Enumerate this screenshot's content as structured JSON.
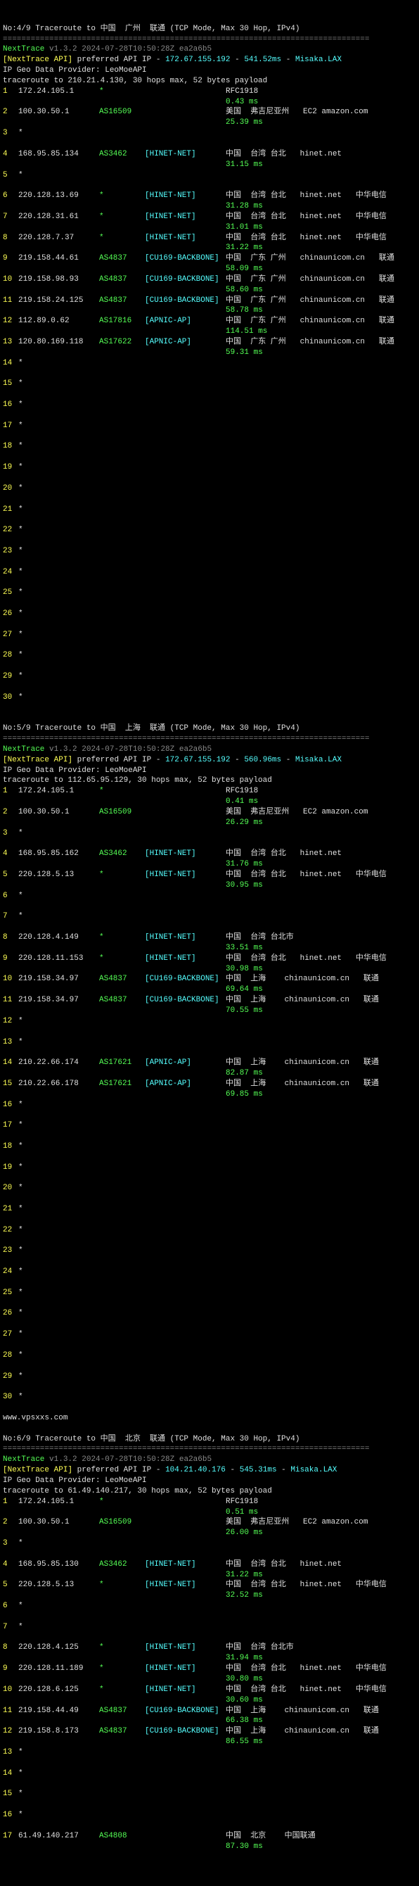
{
  "sections": [
    {
      "title_pre": "No:4/9 Traceroute to ",
      "title_loc": "中国  广州  联通",
      "title_suf": " (TCP Mode, Max 30 Hop, IPv4)",
      "api_ip": "172.67.155.192",
      "api_ms": "541.52ms",
      "isp": "Misaka.LAX",
      "trace_to": "210.21.4.130",
      "hops": [
        {
          "n": "1",
          "ip": "172.24.105.1",
          "as": "*",
          "net": "",
          "loc": "RFC1918",
          "lat": "0.43 ms"
        },
        {
          "n": "2",
          "ip": "100.30.50.1",
          "as": "AS16509",
          "net": "",
          "loc": "美国  弗吉尼亚州   EC2 amazon.com",
          "lat": "25.39 ms"
        },
        {
          "n": "3",
          "ip": "*",
          "as": "",
          "net": "",
          "loc": "",
          "lat": ""
        },
        {
          "n": "4",
          "ip": "168.95.85.134",
          "as": "AS3462",
          "net": "[HINET-NET]",
          "loc": "中国  台湾 台北   hinet.net",
          "lat": "31.15 ms"
        },
        {
          "n": "5",
          "ip": "*",
          "as": "",
          "net": "",
          "loc": "",
          "lat": ""
        },
        {
          "n": "6",
          "ip": "220.128.13.69",
          "as": "*",
          "net": "[HINET-NET]",
          "loc": "中国  台湾 台北   hinet.net   中华电信",
          "lat": "31.28 ms"
        },
        {
          "n": "7",
          "ip": "220.128.31.61",
          "as": "*",
          "net": "[HINET-NET]",
          "loc": "中国  台湾 台北   hinet.net   中华电信",
          "lat": "31.01 ms"
        },
        {
          "n": "8",
          "ip": "220.128.7.37",
          "as": "*",
          "net": "[HINET-NET]",
          "loc": "中国  台湾 台北   hinet.net   中华电信",
          "lat": "31.22 ms"
        },
        {
          "n": "9",
          "ip": "219.158.44.61",
          "as": "AS4837",
          "net": "[CU169-BACKBONE]",
          "loc": "中国  广东 广州   chinaunicom.cn   联通",
          "lat": "58.09 ms"
        },
        {
          "n": "10",
          "ip": "219.158.98.93",
          "as": "AS4837",
          "net": "[CU169-BACKBONE]",
          "loc": "中国  广东 广州   chinaunicom.cn   联通",
          "lat": "58.60 ms"
        },
        {
          "n": "11",
          "ip": "219.158.24.125",
          "as": "AS4837",
          "net": "[CU169-BACKBONE]",
          "loc": "中国  广东 广州   chinaunicom.cn   联通",
          "lat": "58.78 ms"
        },
        {
          "n": "12",
          "ip": "112.89.0.62",
          "as": "AS17816",
          "net": "[APNIC-AP]",
          "loc": "中国  广东 广州   chinaunicom.cn   联通",
          "lat": "114.51 ms"
        },
        {
          "n": "13",
          "ip": "120.80.169.118",
          "as": "AS17622",
          "net": "[APNIC-AP]",
          "loc": "中国  广东 广州   chinaunicom.cn   联通",
          "lat": "59.31 ms"
        },
        {
          "n": "14",
          "ip": "*"
        },
        {
          "n": "15",
          "ip": "*"
        },
        {
          "n": "16",
          "ip": "*"
        },
        {
          "n": "17",
          "ip": "*"
        },
        {
          "n": "18",
          "ip": "*"
        },
        {
          "n": "19",
          "ip": "*"
        },
        {
          "n": "20",
          "ip": "*"
        },
        {
          "n": "21",
          "ip": "*"
        },
        {
          "n": "22",
          "ip": "*"
        },
        {
          "n": "23",
          "ip": "*"
        },
        {
          "n": "24",
          "ip": "*"
        },
        {
          "n": "25",
          "ip": "*"
        },
        {
          "n": "26",
          "ip": "*"
        },
        {
          "n": "27",
          "ip": "*"
        },
        {
          "n": "28",
          "ip": "*"
        },
        {
          "n": "29",
          "ip": "*"
        },
        {
          "n": "30",
          "ip": "*"
        }
      ]
    },
    {
      "title_pre": "No:5/9 Traceroute to ",
      "title_loc": "中国  上海  联通",
      "title_suf": " (TCP Mode, Max 30 Hop, IPv4)",
      "api_ip": "172.67.155.192",
      "api_ms": "560.96ms",
      "isp": "Misaka.LAX",
      "trace_to": "112.65.95.129",
      "hops": [
        {
          "n": "1",
          "ip": "172.24.105.1",
          "as": "*",
          "net": "",
          "loc": "RFC1918",
          "lat": "0.41 ms"
        },
        {
          "n": "2",
          "ip": "100.30.50.1",
          "as": "AS16509",
          "net": "",
          "loc": "美国  弗吉尼亚州   EC2 amazon.com",
          "lat": "26.29 ms"
        },
        {
          "n": "3",
          "ip": "*"
        },
        {
          "n": "4",
          "ip": "168.95.85.162",
          "as": "AS3462",
          "net": "[HINET-NET]",
          "loc": "中国  台湾 台北   hinet.net",
          "lat": "31.76 ms"
        },
        {
          "n": "5",
          "ip": "220.128.5.13",
          "as": "*",
          "net": "[HINET-NET]",
          "loc": "中国  台湾 台北   hinet.net   中华电信",
          "lat": "30.95 ms"
        },
        {
          "n": "6",
          "ip": "*"
        },
        {
          "n": "7",
          "ip": "*"
        },
        {
          "n": "8",
          "ip": "220.128.4.149",
          "as": "*",
          "net": "[HINET-NET]",
          "loc": "中国  台湾 台北市",
          "lat": "33.51 ms"
        },
        {
          "n": "9",
          "ip": "220.128.11.153",
          "as": "*",
          "net": "[HINET-NET]",
          "loc": "中国  台湾 台北   hinet.net   中华电信",
          "lat": "30.98 ms"
        },
        {
          "n": "10",
          "ip": "219.158.34.97",
          "as": "AS4837",
          "net": "[CU169-BACKBONE]",
          "loc": "中国  上海    chinaunicom.cn   联通",
          "lat": "69.64 ms"
        },
        {
          "n": "11",
          "ip": "219.158.34.97",
          "as": "AS4837",
          "net": "[CU169-BACKBONE]",
          "loc": "中国  上海    chinaunicom.cn   联通",
          "lat": "70.55 ms"
        },
        {
          "n": "12",
          "ip": "*"
        },
        {
          "n": "13",
          "ip": "*"
        },
        {
          "n": "14",
          "ip": "210.22.66.174",
          "as": "AS17621",
          "net": "[APNIC-AP]",
          "loc": "中国  上海    chinaunicom.cn   联通",
          "lat": "82.87 ms"
        },
        {
          "n": "15",
          "ip": "210.22.66.178",
          "as": "AS17621",
          "net": "[APNIC-AP]",
          "loc": "中国  上海    chinaunicom.cn   联通",
          "lat": "69.85 ms"
        },
        {
          "n": "16",
          "ip": "*"
        },
        {
          "n": "17",
          "ip": "*"
        },
        {
          "n": "18",
          "ip": "*"
        },
        {
          "n": "19",
          "ip": "*"
        },
        {
          "n": "20",
          "ip": "*"
        },
        {
          "n": "21",
          "ip": "*"
        },
        {
          "n": "22",
          "ip": "*"
        },
        {
          "n": "23",
          "ip": "*"
        },
        {
          "n": "24",
          "ip": "*"
        },
        {
          "n": "25",
          "ip": "*"
        },
        {
          "n": "26",
          "ip": "*"
        },
        {
          "n": "27",
          "ip": "*"
        },
        {
          "n": "28",
          "ip": "*"
        },
        {
          "n": "29",
          "ip": "*"
        },
        {
          "n": "30",
          "ip": "*"
        }
      ],
      "watermark": "www.vpsxxs.com"
    },
    {
      "title_pre": "No:6/9 Traceroute to ",
      "title_loc": "中国  北京  联通",
      "title_suf": " (TCP Mode, Max 30 Hop, IPv4)",
      "api_ip": "104.21.40.176",
      "api_ms": "545.31ms",
      "isp": "Misaka.LAX",
      "trace_to": "61.49.140.217",
      "hops": [
        {
          "n": "1",
          "ip": "172.24.105.1",
          "as": "*",
          "net": "",
          "loc": "RFC1918",
          "lat": "0.51 ms"
        },
        {
          "n": "2",
          "ip": "100.30.50.1",
          "as": "AS16509",
          "net": "",
          "loc": "美国  弗吉尼亚州   EC2 amazon.com",
          "lat": "26.00 ms"
        },
        {
          "n": "3",
          "ip": "*"
        },
        {
          "n": "4",
          "ip": "168.95.85.130",
          "as": "AS3462",
          "net": "[HINET-NET]",
          "loc": "中国  台湾 台北   hinet.net",
          "lat": "31.22 ms"
        },
        {
          "n": "5",
          "ip": "220.128.5.13",
          "as": "*",
          "net": "[HINET-NET]",
          "loc": "中国  台湾 台北   hinet.net   中华电信",
          "lat": "32.52 ms"
        },
        {
          "n": "6",
          "ip": "*"
        },
        {
          "n": "7",
          "ip": "*"
        },
        {
          "n": "8",
          "ip": "220.128.4.125",
          "as": "*",
          "net": "[HINET-NET]",
          "loc": "中国  台湾 台北市",
          "lat": "31.94 ms"
        },
        {
          "n": "9",
          "ip": "220.128.11.189",
          "as": "*",
          "net": "[HINET-NET]",
          "loc": "中国  台湾 台北   hinet.net   中华电信",
          "lat": "30.80 ms"
        },
        {
          "n": "10",
          "ip": "220.128.6.125",
          "as": "*",
          "net": "[HINET-NET]",
          "loc": "中国  台湾 台北   hinet.net   中华电信",
          "lat": "30.60 ms"
        },
        {
          "n": "11",
          "ip": "219.158.44.49",
          "as": "AS4837",
          "net": "[CU169-BACKBONE]",
          "loc": "中国  上海    chinaunicom.cn   联通",
          "lat": "66.38 ms"
        },
        {
          "n": "12",
          "ip": "219.158.8.173",
          "as": "AS4837",
          "net": "[CU169-BACKBONE]",
          "loc": "中国  上海    chinaunicom.cn   联通",
          "lat": "86.55 ms"
        },
        {
          "n": "13",
          "ip": "*"
        },
        {
          "n": "14",
          "ip": "*"
        },
        {
          "n": "15",
          "ip": "*"
        },
        {
          "n": "16",
          "ip": "*"
        },
        {
          "n": "17",
          "ip": "61.49.140.217",
          "as": "AS4808",
          "net": "",
          "loc": "中国  北京    中国联通",
          "lat": "87.30 ms"
        }
      ]
    }
  ],
  "ver": "v1.3.2 2024-07-28T10:50:28Z ea2a6b5",
  "geo_provider": "IP Geo Data Provider: LeoMoeAPI",
  "sep": "===============================================================================",
  "sep2": "-------------------------------------------------------------------------------",
  "max_bytes": ", 30 hops max, 52 bytes payload"
}
